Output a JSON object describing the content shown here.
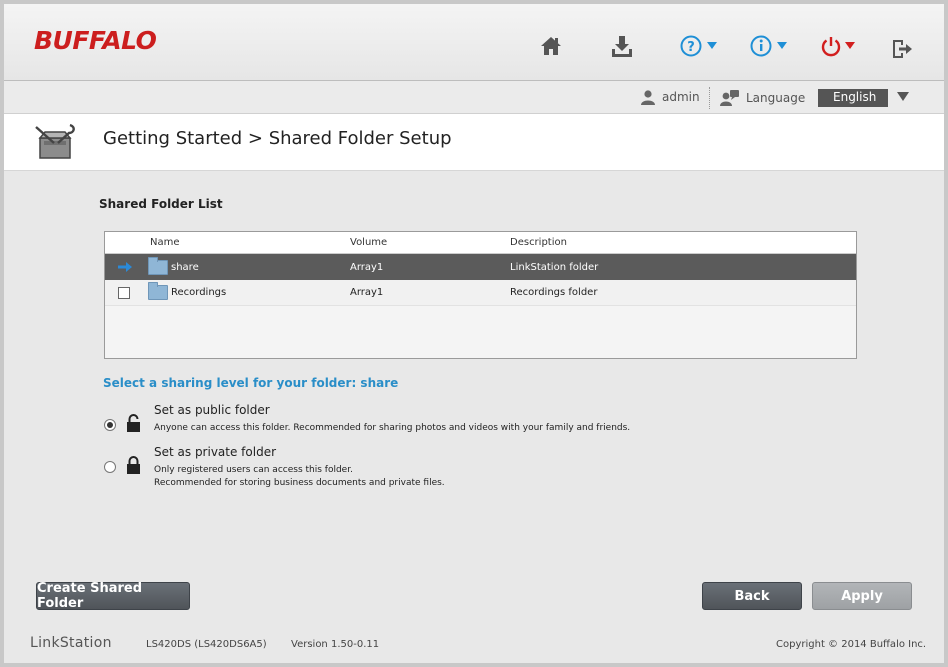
{
  "brand": {
    "logo_text": "BUFFALO",
    "product_logo": "LinkStation"
  },
  "topnav": {
    "icons": [
      "home-icon",
      "download-icon",
      "help-icon",
      "info-icon",
      "power-icon",
      "logout-icon"
    ]
  },
  "userbar": {
    "user": "admin",
    "language_label": "Language",
    "language_value": "English"
  },
  "page": {
    "title": "Getting Started > Shared Folder Setup"
  },
  "folder_list": {
    "heading": "Shared Folder List",
    "columns": [
      "Name",
      "Volume",
      "Description"
    ],
    "rows": [
      {
        "name": "share",
        "volume": "Array1",
        "description": "LinkStation folder",
        "selected": true
      },
      {
        "name": "Recordings",
        "volume": "Array1",
        "description": "Recordings folder",
        "selected": false
      }
    ]
  },
  "sharing": {
    "prompt": "Select a sharing level for your folder: share",
    "options": [
      {
        "label": "Set as public folder",
        "desc_line1": "Anyone can access this folder. Recommended for sharing photos and videos with your family and friends.",
        "desc_line2": "",
        "checked": true
      },
      {
        "label": "Set as private folder",
        "desc_line1": "Only registered users can access this folder.",
        "desc_line2": "Recommended for storing business documents and private files.",
        "checked": false
      }
    ]
  },
  "buttons": {
    "create": "Create Shared Folder",
    "back": "Back",
    "apply": "Apply"
  },
  "footer": {
    "model": "LS420DS (LS420DS6A5)",
    "version": "Version 1.50-0.11",
    "copyright": "Copyright © 2014 Buffalo Inc."
  },
  "colors": {
    "accent": "#2a8ec8",
    "logo_red": "#cc1e1e",
    "power_red": "#d21f1f",
    "blue_icon": "#1e8fd6"
  }
}
